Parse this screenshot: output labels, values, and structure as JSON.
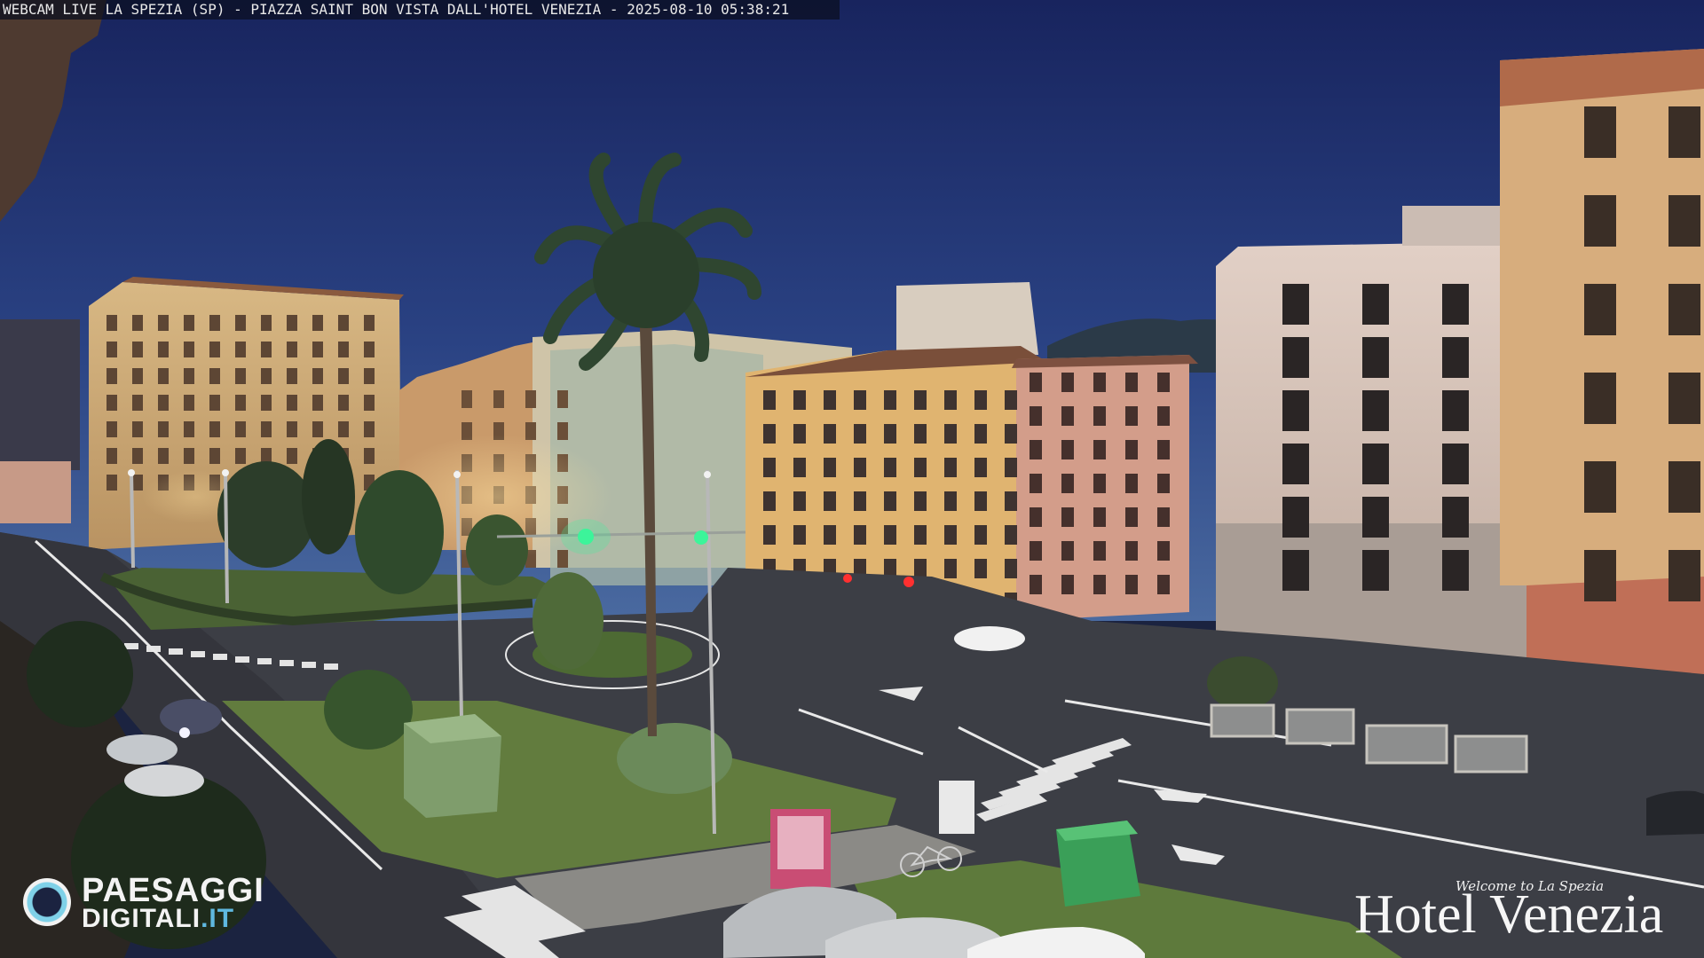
{
  "caption": "WEBCAM LIVE LA SPEZIA (SP) - PIAZZA SAINT BON VISTA DALL'HOTEL VENEZIA - 2025-08-10 05:38:21",
  "logo_left": {
    "line1": "PAESAGGI",
    "line2_main": "DIGITALI",
    "line2_accent": ".IT"
  },
  "brand_right": {
    "welcome": "Welcome to La Spezia",
    "name": "Hotel Venezia"
  },
  "scene": {
    "sky_top": "#1c2a66",
    "sky_horizon": "#3c5890",
    "road_color": "#3d3e44",
    "grass_color": "#5f7a3c",
    "icons": [
      "palm-tree-icon",
      "traffic-light-icon",
      "car-icon",
      "bicycle-icon"
    ]
  }
}
